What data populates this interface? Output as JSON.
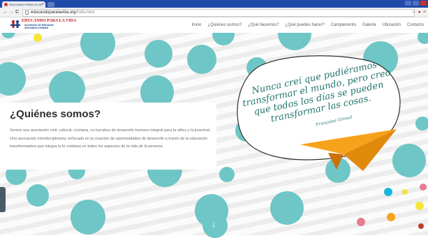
{
  "browser": {
    "tab_title": "EDUCANDO PARA LA VID",
    "tab_close": "×",
    "back": "←",
    "forward": "→",
    "reload": "C",
    "url_domain": "educandoparalavida.org",
    "url_path": "/Edfa.html",
    "star": "☆",
    "menu": "≡"
  },
  "logo": {
    "title": "EDUCANDO PARA LA VIDA",
    "subtitle_line1": "Asociación de Educación",
    "subtitle_line2": "Alternativa Cristiana"
  },
  "nav": {
    "items": [
      "Inicio",
      "¿Quiénes somos?",
      "¿Qué hacemos?",
      "¿Qué puedes hacer?",
      "Campamento",
      "Galería",
      "Ubicación",
      "Contacto"
    ]
  },
  "about": {
    "heading": "¿Quiénes somos?",
    "body": "Somos una asociación civil, cultural, cristiana, no lucrativa de desarrollo humano integral para la niñez y la juventud. Una asociación interdisciplinaria, enfocada en la creación de oportunidades de desarrollo a través de la educación transformadora que integra la fe cristiana en todos los aspectos de la vida de la persona."
  },
  "quote": {
    "text": "Nunca creí que pudiéramos transformar el mundo, pero creo que todos los días se pueden transformar las cosas.",
    "author": "Françoise Giroud"
  },
  "scroll_icon": "↓",
  "colors": {
    "teal": "#6fc6c6",
    "quote_text": "#23756f",
    "plane": "#f7a21b",
    "brand_red": "#c01818",
    "brand_blue": "#1a3f8f"
  }
}
